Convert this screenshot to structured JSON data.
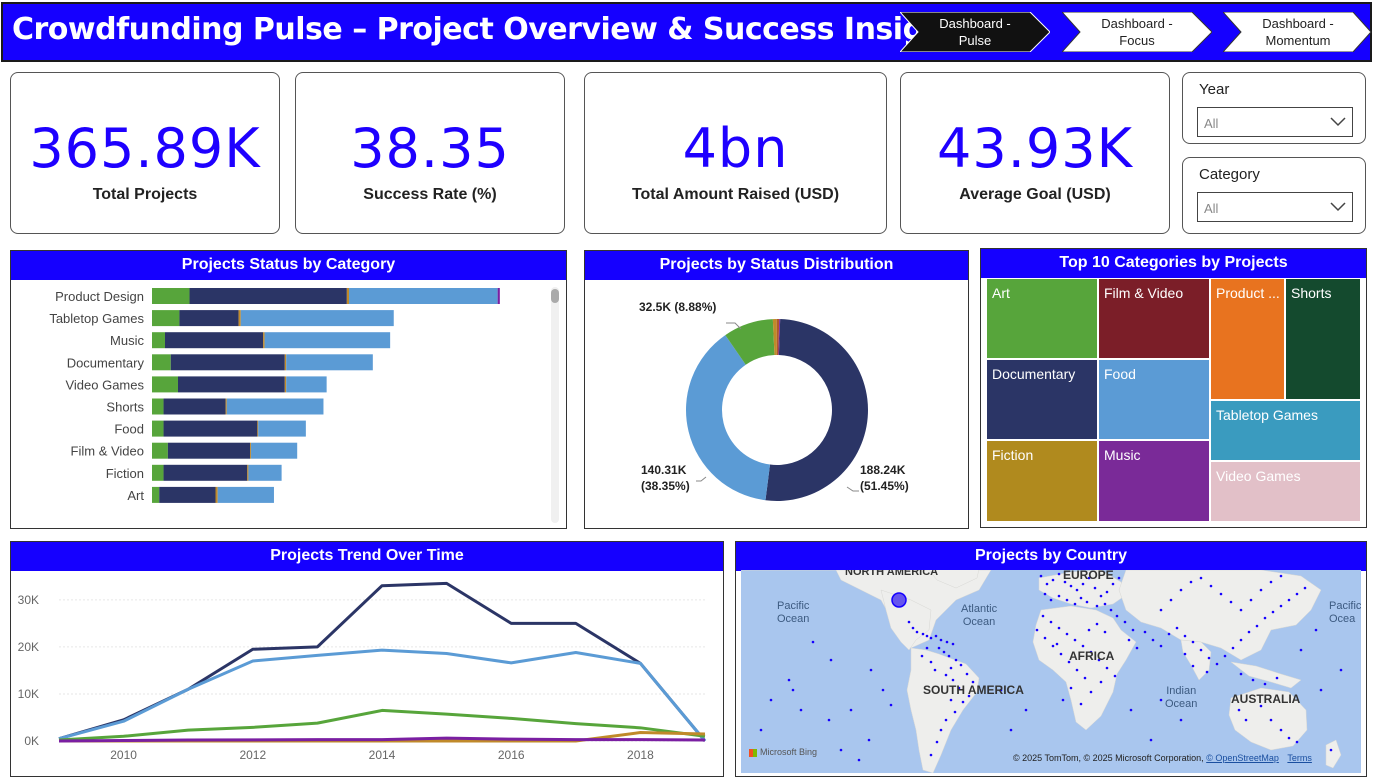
{
  "header": {
    "title": "Crowdfunding Pulse – Project Overview & Success Insights",
    "nav": [
      {
        "line1": "Dashboard -",
        "line2": "Pulse",
        "active": true
      },
      {
        "line1": "Dashboard -",
        "line2": "Focus",
        "active": false
      },
      {
        "line1": "Dashboard -",
        "line2": "Momentum",
        "active": false
      }
    ]
  },
  "kpis": [
    {
      "value": "365.89K",
      "label": "Total Projects"
    },
    {
      "value": "38.35",
      "label": "Success Rate (%)"
    },
    {
      "value": "4bn",
      "label": "Total Amount Raised (USD)"
    },
    {
      "value": "43.93K",
      "label": "Average Goal (USD)"
    }
  ],
  "slicers": [
    {
      "title": "Year",
      "value": "All"
    },
    {
      "title": "Category",
      "value": "All"
    }
  ],
  "colors": {
    "accent": "#1500ff",
    "kpi": "#1e00ff",
    "failed": "#2b3566",
    "successful": "#5b9bd5",
    "canceled": "#57a53b",
    "other1": "#c08a2a",
    "other2": "#7a1fa2"
  },
  "charts": {
    "status_by_category": {
      "title": "Projects Status by Category",
      "type": "bar",
      "categories": [
        "Product Design",
        "Tabletop Games",
        "Music",
        "Documentary",
        "Video Games",
        "Shorts",
        "Food",
        "Film & Video",
        "Fiction",
        "Art"
      ],
      "series": [
        {
          "values": [
            2600,
            1900,
            900,
            1300,
            1800,
            800,
            800,
            1100,
            800,
            500
          ]
        },
        {
          "values": [
            10900,
            4100,
            6800,
            7900,
            7400,
            4300,
            6500,
            5700,
            5800,
            3900
          ]
        },
        {
          "values": [
            150,
            150,
            100,
            100,
            100,
            80,
            60,
            60,
            80,
            150
          ]
        },
        {
          "values": [
            10300,
            10600,
            8700,
            6000,
            2800,
            6700,
            3300,
            3200,
            2300,
            3900
          ]
        },
        {
          "values": [
            150,
            0,
            0,
            0,
            0,
            0,
            0,
            0,
            0,
            0
          ]
        }
      ]
    },
    "status_distribution": {
      "title": "Projects by Status Distribution",
      "type": "pie",
      "slices": [
        {
          "value": 188.24,
          "pct": 51.45,
          "label_value": "188.24K",
          "label_pct": "(51.45%)"
        },
        {
          "value": 140.31,
          "pct": 38.35,
          "label_value": "140.31K",
          "label_pct": "(38.35%)"
        },
        {
          "value": 32.5,
          "pct": 8.88,
          "label_value": "32.5K (8.88%)",
          "label_pct": ""
        },
        {
          "value": 2.5,
          "pct": 0.7,
          "label_value": "",
          "label_pct": ""
        },
        {
          "value": 1.6,
          "pct": 0.45,
          "label_value": "",
          "label_pct": ""
        },
        {
          "value": 0.6,
          "pct": 0.17,
          "label_value": "",
          "label_pct": ""
        }
      ]
    },
    "top10_categories": {
      "title": "Top 10 Categories by Projects",
      "type": "treemap",
      "items": [
        {
          "label": "Art",
          "color": "#57a53b"
        },
        {
          "label": "Film & Video",
          "color": "#7b1e28"
        },
        {
          "label": "Product ...",
          "color": "#e8731f"
        },
        {
          "label": "Shorts",
          "color": "#144a2e"
        },
        {
          "label": "Documentary",
          "color": "#2b3566"
        },
        {
          "label": "Food",
          "color": "#5b9bd5"
        },
        {
          "label": "Tabletop Games",
          "color": "#3a9bbf"
        },
        {
          "label": "Fiction",
          "color": "#b08a1e"
        },
        {
          "label": "Music",
          "color": "#7a2a98"
        },
        {
          "label": "Video Games",
          "color": "#e2c0c8"
        }
      ]
    },
    "trend": {
      "title": "Projects Trend Over Time",
      "type": "line",
      "x": [
        2009,
        2010,
        2011,
        2012,
        2013,
        2014,
        2015,
        2016,
        2017,
        2018,
        2019
      ],
      "x_ticks": [
        "2010",
        "2012",
        "2014",
        "2016",
        "2018"
      ],
      "y_ticks": [
        "0K",
        "10K",
        "20K",
        "30K"
      ],
      "ylim": [
        0,
        34000
      ],
      "series": [
        {
          "values": [
            500,
            4500,
            11000,
            19500,
            20000,
            33000,
            33500,
            25000,
            25000,
            16500,
            0
          ]
        },
        {
          "values": [
            500,
            4200,
            11000,
            17000,
            18200,
            19300,
            18600,
            16600,
            18800,
            16500,
            0
          ]
        },
        {
          "values": [
            200,
            1000,
            2300,
            2900,
            3800,
            6500,
            5700,
            4800,
            3700,
            2800,
            1000
          ]
        },
        {
          "values": [
            0,
            0,
            0,
            0,
            0,
            0,
            0,
            0,
            0,
            1800,
            1500
          ]
        },
        {
          "values": [
            0,
            100,
            200,
            250,
            300,
            300,
            600,
            400,
            300,
            300,
            200
          ]
        }
      ]
    },
    "by_country": {
      "title": "Projects by Country",
      "labels": {
        "north_america": "NORTH AMERICA",
        "europe": "EUROPE",
        "africa": "AFRICA",
        "south_america": "SOUTH AMERICA",
        "australia": "AUSTRALIA",
        "pacific_left": "Pacific\nOcean",
        "atlantic": "Atlantic\nOcean",
        "indian": "Indian\nOcean",
        "pacific_right": "Pacific\nOcea"
      },
      "brand": "Microsoft Bing",
      "copyright": "© 2025 TomTom, © 2025 Microsoft Corporation,",
      "osm": "© OpenStreetMap",
      "terms": "Terms"
    }
  }
}
